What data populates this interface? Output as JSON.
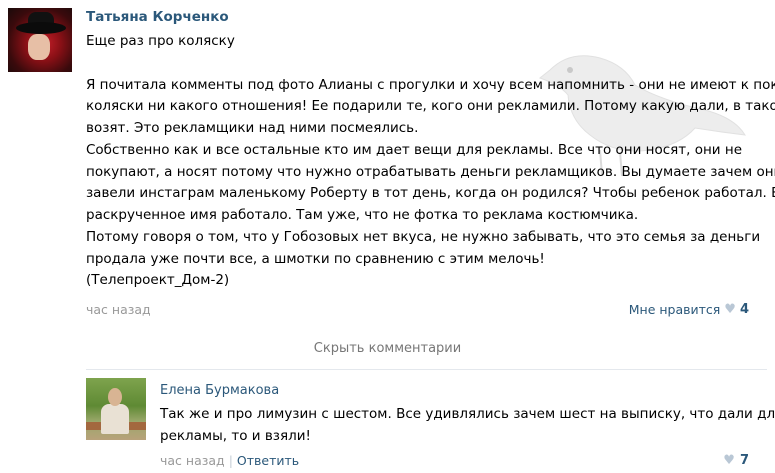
{
  "post": {
    "author": "Татьяна Корченко",
    "lines": [
      "Еще раз про коляску",
      "",
      "Я почитала комменты под фото Алианы с прогулки и хочу всем напомнить - они не имеют к покупке",
      "коляски ни какого отношения! Ее подарили те, кого они рекламили. Потому какую дали, в такой и",
      "возят. Это рекламщики над ними посмеялись.",
      "Собственно как и все остальные кто им дает вещи для рекламы. Все что они носят, они не",
      "покупают, а носят потому что нужно отрабатывать деньги рекламщиков. Вы думаете зачем они",
      "завели инстаграм маленькому Роберту в тот день, когда он родился? Чтобы ребенок работал. Его",
      "раскрученное имя работало. Там уже, что не фотка то реклама костюмчика.",
      "Потому говоря о том, что у Гобозовых нет вкуса, не нужно забывать, что это семья за деньги",
      "продала уже почти все, а шмотки по сравнению с этим мелочь!",
      "(Телепроект_Дом-2)"
    ],
    "time": "час назад",
    "like_label": "Мне нравится",
    "like_count": "4"
  },
  "hide_comments_label": "Скрыть комментарии",
  "comment": {
    "author": "Елена Бурмакова",
    "lines": [
      "Так же и про лимузин с шестом. Все удивлялись зачем шест на выписку, что дали для",
      "рекламы, то и взяли!"
    ],
    "time": "час назад",
    "separator": "|",
    "reply_label": "Ответить",
    "like_count": "7"
  },
  "colors": {
    "link": "#2b587a",
    "muted": "#999999"
  }
}
